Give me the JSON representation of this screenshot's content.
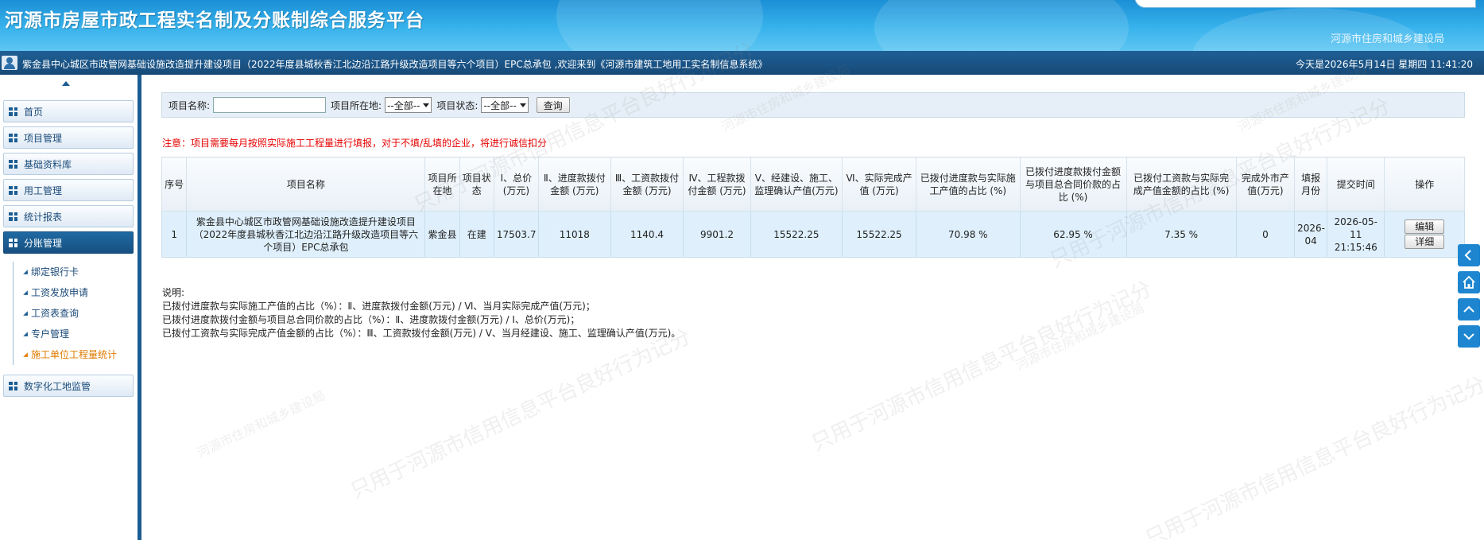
{
  "header": {
    "title": "河源市房屋市政工程实名制及分账制综合服务平台",
    "org": "河源市住房和城乡建设局"
  },
  "infobar": {
    "welcome": "紫金县中心城区市政管网基础设施改造提升建设项目（2022年度县城秋香江北边沿江路升级改造项目等六个项目）EPC总承包 ,欢迎来到《河源市建筑工地用工实名制信息系统》",
    "datetime": "今天是2026年5月14日 星期四 11:41:20"
  },
  "sidebar": {
    "items": [
      {
        "label": "首页"
      },
      {
        "label": "项目管理"
      },
      {
        "label": "基础资料库"
      },
      {
        "label": "用工管理"
      },
      {
        "label": "统计报表"
      },
      {
        "label": "分账管理"
      }
    ],
    "submenu": [
      {
        "label": "绑定银行卡"
      },
      {
        "label": "工资发放申请"
      },
      {
        "label": "工资表查询"
      },
      {
        "label": "专户管理"
      },
      {
        "label": "施工单位工程量统计"
      }
    ],
    "last_item": {
      "label": "数字化工地监管"
    }
  },
  "search": {
    "name_label": "项目名称:",
    "location_label": "项目所在地:",
    "location_value": "--全部--",
    "status_label": "项目状态:",
    "status_value": "--全部--",
    "query_button": "查询"
  },
  "notice": "注意：项目需要每月按照实际施工工程量进行填报，对于不填/乱填的企业，将进行诚信扣分",
  "table": {
    "headers": [
      "序号",
      "项目名称",
      "项目所在地",
      "项目状态",
      "Ⅰ、总价(万元)",
      "Ⅱ、进度款拨付金额 (万元)",
      "Ⅲ、工资款拨付金额 (万元)",
      "Ⅳ、工程款拨付金额 (万元)",
      "Ⅴ、经建设、施工、监理确认产值(万元)",
      "Ⅵ、实际完成产值 (万元)",
      "已拨付进度款与实际施工产值的占比 (%)",
      "已拨付进度款拨付金额与项目总合同价款的占比 (%)",
      "已拨付工资款与实际完成产值金额的占比 (%)",
      "完成外市产值(万元)",
      "填报月份",
      "提交时间",
      "操作"
    ],
    "rows": [
      {
        "no": "1",
        "name": "紫金县中心城区市政管网基础设施改造提升建设项目（2022年度县城秋香江北边沿江路升级改造项目等六个项目）EPC总承包",
        "location": "紫金县",
        "status": "在建",
        "total": "17503.7",
        "progress_paid": "11018",
        "wage_paid": "1140.4",
        "engineering_paid": "9901.2",
        "confirmed_output": "15522.25",
        "actual_output": "15522.25",
        "ratio_progress_output": "70.98 %",
        "ratio_progress_contract": "62.95 %",
        "ratio_wage_output": "7.35 %",
        "other_city_output": "0",
        "month": "2026-04",
        "submit_time": "2026-05-11 21:15:46",
        "edit_button": "编辑",
        "detail_button": "详细"
      }
    ]
  },
  "notes": {
    "title": "说明:",
    "line1": "已拨付进度款与实际施工产值的占比（%）：Ⅱ、进度款拨付金额(万元) / Ⅵ、当月实际完成产值(万元)；",
    "line2": "已拨付进度款拨付金额与项目总合同价款的占比（%）：Ⅱ、进度款拨付金额(万元) / Ⅰ、总价(万元)；",
    "line3": "已拨付工资款与实际完成产值金额的占比（%）：Ⅲ、工资款拨付金额(万元) / Ⅴ、当月经建设、施工、监理确认产值(万元)。"
  },
  "watermark": {
    "text_a": "只用于河源市信用信息平台良好行为记分",
    "text_b": "河源市住房和城乡建设局"
  },
  "colors": {
    "header_blue": "#1b8fd6",
    "nav_dark": "#164a78",
    "row_bg": "#dff0fc",
    "notice_red": "#e60000",
    "current_submenu": "#e07b00"
  }
}
